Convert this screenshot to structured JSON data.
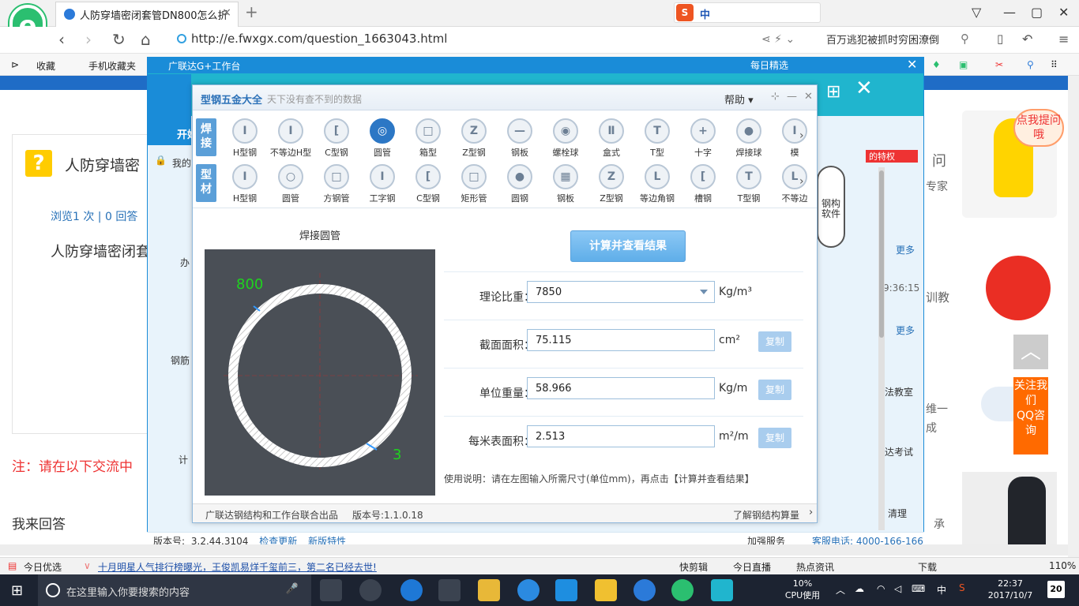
{
  "browser": {
    "tab_title": "人防穿墙密闭套管DN800怎么折",
    "tab_close": "×",
    "new_tab": "+",
    "url": "http://e.fwxgx.com/question_1663043.html",
    "search_text": "百万逃犯被抓时穷困潦倒",
    "ime_label": "中",
    "logo_letter": "e",
    "bookmarks": [
      "收藏",
      "手机收藏夹"
    ],
    "zoom": "110%"
  },
  "page": {
    "question_title": "人防穿墙密",
    "stats": "浏览1 次 | 0 回答",
    "question_text": "人防穿墙密闭套",
    "note": "注：请在以下交流中",
    "reply_label": "我来回答",
    "follow_label": "关注我们",
    "qq_label": "QQ咨询",
    "ask_badge": "点我提问哦",
    "more1": "更多",
    "more2": "更多",
    "time": "9:36:15",
    "right_texts": [
      "问",
      "专家",
      "训教",
      "维一",
      "成",
      "承"
    ],
    "host_tabs": [
      "办",
      "钢筋",
      "计"
    ],
    "side_labels": [
      "法教室",
      "达考试",
      "清理"
    ],
    "privilege": "的特权"
  },
  "host": {
    "title": "广联达G+工作台",
    "daily": "每日精选",
    "my_label": "我的",
    "open_label": "开始",
    "version_label": "版本号:",
    "version_value": "3.2.44.3104",
    "check_update": "检查更新",
    "new_features": "新版特性",
    "join_label": "加强服务",
    "phone_label": "客服电话: 4000-166-166"
  },
  "dialog": {
    "title": "型钢五金大全",
    "subtitle": "天下没有查不到的数据",
    "help": "帮助",
    "welding_tag": "焊接",
    "profile_tag": "型材",
    "welding_items": [
      "H型钢",
      "不等边H型",
      "C型钢",
      "圆管",
      "箱型",
      "Z型钢",
      "钢板",
      "螺栓球",
      "盒式",
      "T型",
      "十字",
      "焊接球",
      "模"
    ],
    "profile_items": [
      "H型钢",
      "圆管",
      "方钢管",
      "工字钢",
      "C型钢",
      "矩形管",
      "圆钢",
      "钢板",
      "Z型钢",
      "等边角钢",
      "槽钢",
      "T型钢",
      "不等边"
    ],
    "welding_glyphs": [
      "I",
      "I",
      "[",
      "◎",
      "□",
      "Z",
      "—",
      "◉",
      "Ⅱ",
      "T",
      "+",
      "●",
      "I"
    ],
    "profile_glyphs": [
      "I",
      "○",
      "□",
      "I",
      "[",
      "□",
      "●",
      "▦",
      "Z",
      "L",
      "[",
      "T",
      "L"
    ],
    "selected_welding": "圆管",
    "figure_title": "焊接圆管",
    "dim_diameter": "800",
    "dim_thickness": "3",
    "calc_button": "计算并查看结果",
    "fields": [
      {
        "label": "理论比重：",
        "value": "7850",
        "unit": "Kg/m³",
        "copy": ""
      },
      {
        "label": "截面面积：",
        "value": "75.115",
        "unit": "cm²",
        "copy": "复制"
      },
      {
        "label": "单位重量：",
        "value": "58.966",
        "unit": "Kg/m",
        "copy": "复制"
      },
      {
        "label": "每米表面积：",
        "value": "2.513",
        "unit": "m²/m",
        "copy": "复制"
      }
    ],
    "usage": "使用说明：请在左图输入所需尺寸(单位mm)，再点击【计算并查看结果】",
    "footer_left": "广联达钢结构和工作台联合出品",
    "footer_version": "版本号:1.1.0.18",
    "footer_right": "了解钢结构算量",
    "mascot_text": "钢构软件"
  },
  "statusbar": {
    "left": "今日优选",
    "news": "十月明星人气排行榜曝光，王俊凯易烊千玺前三，第二名已经去世!",
    "items": [
      "快剪辑",
      "今日直播",
      "热点资讯",
      "下载"
    ],
    "zoom": "110%"
  },
  "taskbar": {
    "search_placeholder": "在这里输入你要搜索的内容",
    "cpu_value": "10%",
    "cpu_label": "CPU使用",
    "ime": "中",
    "time": "22:37",
    "date": "2017/10/7",
    "notif_count": "20"
  }
}
